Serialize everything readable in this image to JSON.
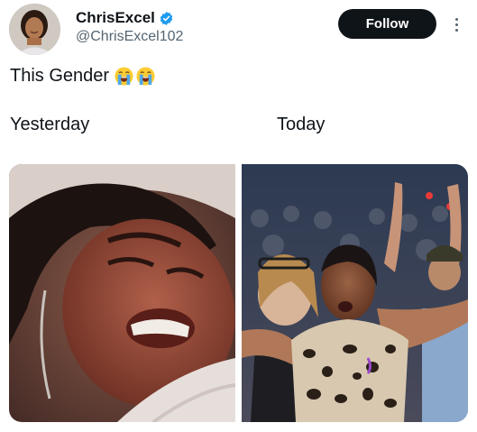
{
  "user": {
    "display_name": "ChrisExcel",
    "handle": "@ChrisExcel102",
    "verified_icon": "verified-badge-icon",
    "avatar_icon": "avatar"
  },
  "actions": {
    "follow_label": "Follow",
    "more_icon": "more-options-icon"
  },
  "tweet": {
    "text": "This Gender",
    "emojis": [
      "loudly-crying-face-emoji",
      "loudly-crying-face-emoji"
    ]
  },
  "meme": {
    "left_caption": "Yesterday",
    "right_caption": "Today",
    "left_image": "crying-woman-photo",
    "right_image": "worshipping-woman-photo"
  },
  "colors": {
    "text": "#0f1419",
    "secondary": "#536471",
    "verified": "#1d9bf0",
    "follow_bg": "#0f1419",
    "follow_text": "#ffffff"
  }
}
